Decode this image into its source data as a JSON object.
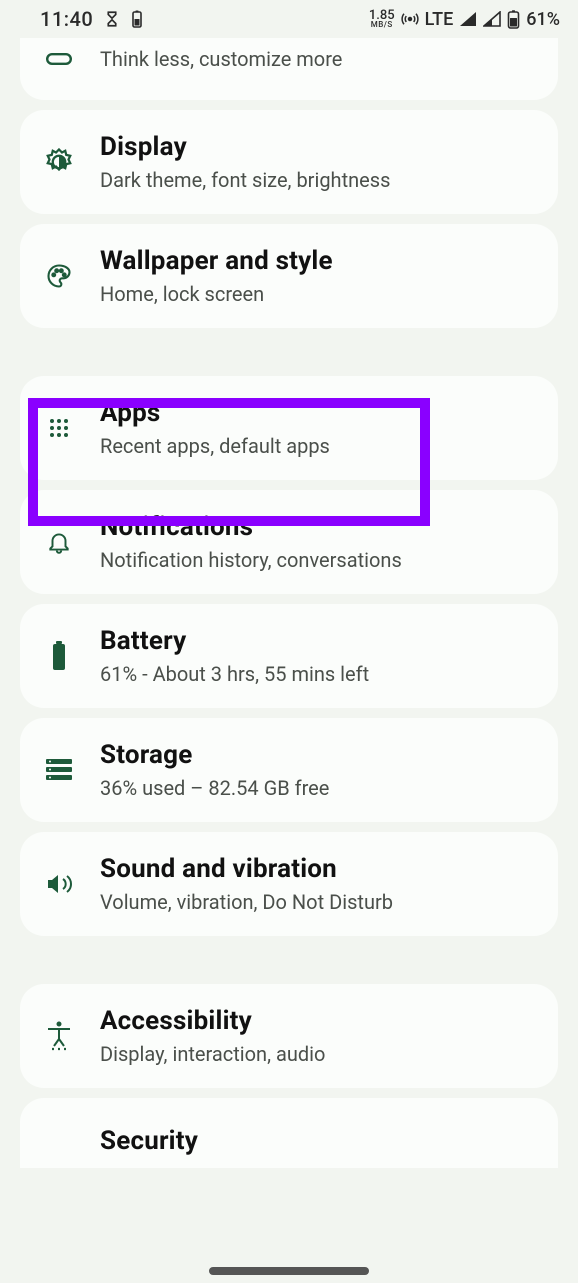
{
  "status": {
    "time": "11:40",
    "net_speed_value": "1.85",
    "net_speed_unit": "MB/S",
    "net_label": "LTE",
    "battery_pct": "61%"
  },
  "items": {
    "customize": {
      "subtitle": "Think less, customize more"
    },
    "display": {
      "title": "Display",
      "subtitle": "Dark theme, font size, brightness"
    },
    "wallpaper": {
      "title": "Wallpaper and style",
      "subtitle": "Home, lock screen"
    },
    "apps": {
      "title": "Apps",
      "subtitle": "Recent apps, default apps"
    },
    "notifications": {
      "title": "Notifications",
      "subtitle": "Notification history, conversations"
    },
    "battery": {
      "title": "Battery",
      "subtitle": "61% - About 3 hrs, 55 mins left"
    },
    "storage": {
      "title": "Storage",
      "subtitle": "36% used – 82.54 GB free"
    },
    "sound": {
      "title": "Sound and vibration",
      "subtitle": "Volume, vibration, Do Not Disturb"
    },
    "accessibility": {
      "title": "Accessibility",
      "subtitle": "Display, interaction, audio"
    },
    "security": {
      "title": "Security"
    }
  }
}
